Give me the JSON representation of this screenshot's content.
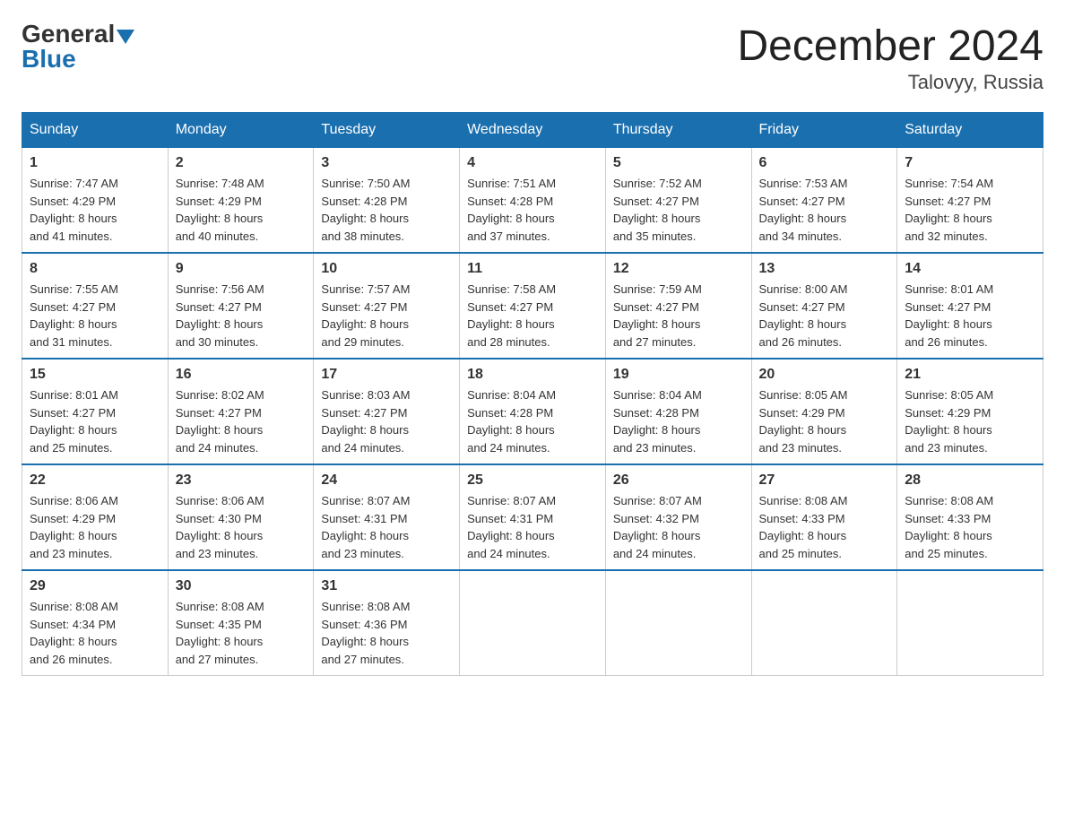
{
  "logo": {
    "general": "General",
    "blue": "Blue"
  },
  "title": "December 2024",
  "location": "Talovyy, Russia",
  "days_of_week": [
    "Sunday",
    "Monday",
    "Tuesday",
    "Wednesday",
    "Thursday",
    "Friday",
    "Saturday"
  ],
  "weeks": [
    [
      {
        "day": "1",
        "info": "Sunrise: 7:47 AM\nSunset: 4:29 PM\nDaylight: 8 hours\nand 41 minutes."
      },
      {
        "day": "2",
        "info": "Sunrise: 7:48 AM\nSunset: 4:29 PM\nDaylight: 8 hours\nand 40 minutes."
      },
      {
        "day": "3",
        "info": "Sunrise: 7:50 AM\nSunset: 4:28 PM\nDaylight: 8 hours\nand 38 minutes."
      },
      {
        "day": "4",
        "info": "Sunrise: 7:51 AM\nSunset: 4:28 PM\nDaylight: 8 hours\nand 37 minutes."
      },
      {
        "day": "5",
        "info": "Sunrise: 7:52 AM\nSunset: 4:27 PM\nDaylight: 8 hours\nand 35 minutes."
      },
      {
        "day": "6",
        "info": "Sunrise: 7:53 AM\nSunset: 4:27 PM\nDaylight: 8 hours\nand 34 minutes."
      },
      {
        "day": "7",
        "info": "Sunrise: 7:54 AM\nSunset: 4:27 PM\nDaylight: 8 hours\nand 32 minutes."
      }
    ],
    [
      {
        "day": "8",
        "info": "Sunrise: 7:55 AM\nSunset: 4:27 PM\nDaylight: 8 hours\nand 31 minutes."
      },
      {
        "day": "9",
        "info": "Sunrise: 7:56 AM\nSunset: 4:27 PM\nDaylight: 8 hours\nand 30 minutes."
      },
      {
        "day": "10",
        "info": "Sunrise: 7:57 AM\nSunset: 4:27 PM\nDaylight: 8 hours\nand 29 minutes."
      },
      {
        "day": "11",
        "info": "Sunrise: 7:58 AM\nSunset: 4:27 PM\nDaylight: 8 hours\nand 28 minutes."
      },
      {
        "day": "12",
        "info": "Sunrise: 7:59 AM\nSunset: 4:27 PM\nDaylight: 8 hours\nand 27 minutes."
      },
      {
        "day": "13",
        "info": "Sunrise: 8:00 AM\nSunset: 4:27 PM\nDaylight: 8 hours\nand 26 minutes."
      },
      {
        "day": "14",
        "info": "Sunrise: 8:01 AM\nSunset: 4:27 PM\nDaylight: 8 hours\nand 26 minutes."
      }
    ],
    [
      {
        "day": "15",
        "info": "Sunrise: 8:01 AM\nSunset: 4:27 PM\nDaylight: 8 hours\nand 25 minutes."
      },
      {
        "day": "16",
        "info": "Sunrise: 8:02 AM\nSunset: 4:27 PM\nDaylight: 8 hours\nand 24 minutes."
      },
      {
        "day": "17",
        "info": "Sunrise: 8:03 AM\nSunset: 4:27 PM\nDaylight: 8 hours\nand 24 minutes."
      },
      {
        "day": "18",
        "info": "Sunrise: 8:04 AM\nSunset: 4:28 PM\nDaylight: 8 hours\nand 24 minutes."
      },
      {
        "day": "19",
        "info": "Sunrise: 8:04 AM\nSunset: 4:28 PM\nDaylight: 8 hours\nand 23 minutes."
      },
      {
        "day": "20",
        "info": "Sunrise: 8:05 AM\nSunset: 4:29 PM\nDaylight: 8 hours\nand 23 minutes."
      },
      {
        "day": "21",
        "info": "Sunrise: 8:05 AM\nSunset: 4:29 PM\nDaylight: 8 hours\nand 23 minutes."
      }
    ],
    [
      {
        "day": "22",
        "info": "Sunrise: 8:06 AM\nSunset: 4:29 PM\nDaylight: 8 hours\nand 23 minutes."
      },
      {
        "day": "23",
        "info": "Sunrise: 8:06 AM\nSunset: 4:30 PM\nDaylight: 8 hours\nand 23 minutes."
      },
      {
        "day": "24",
        "info": "Sunrise: 8:07 AM\nSunset: 4:31 PM\nDaylight: 8 hours\nand 23 minutes."
      },
      {
        "day": "25",
        "info": "Sunrise: 8:07 AM\nSunset: 4:31 PM\nDaylight: 8 hours\nand 24 minutes."
      },
      {
        "day": "26",
        "info": "Sunrise: 8:07 AM\nSunset: 4:32 PM\nDaylight: 8 hours\nand 24 minutes."
      },
      {
        "day": "27",
        "info": "Sunrise: 8:08 AM\nSunset: 4:33 PM\nDaylight: 8 hours\nand 25 minutes."
      },
      {
        "day": "28",
        "info": "Sunrise: 8:08 AM\nSunset: 4:33 PM\nDaylight: 8 hours\nand 25 minutes."
      }
    ],
    [
      {
        "day": "29",
        "info": "Sunrise: 8:08 AM\nSunset: 4:34 PM\nDaylight: 8 hours\nand 26 minutes."
      },
      {
        "day": "30",
        "info": "Sunrise: 8:08 AM\nSunset: 4:35 PM\nDaylight: 8 hours\nand 27 minutes."
      },
      {
        "day": "31",
        "info": "Sunrise: 8:08 AM\nSunset: 4:36 PM\nDaylight: 8 hours\nand 27 minutes."
      },
      {
        "day": "",
        "info": ""
      },
      {
        "day": "",
        "info": ""
      },
      {
        "day": "",
        "info": ""
      },
      {
        "day": "",
        "info": ""
      }
    ]
  ]
}
